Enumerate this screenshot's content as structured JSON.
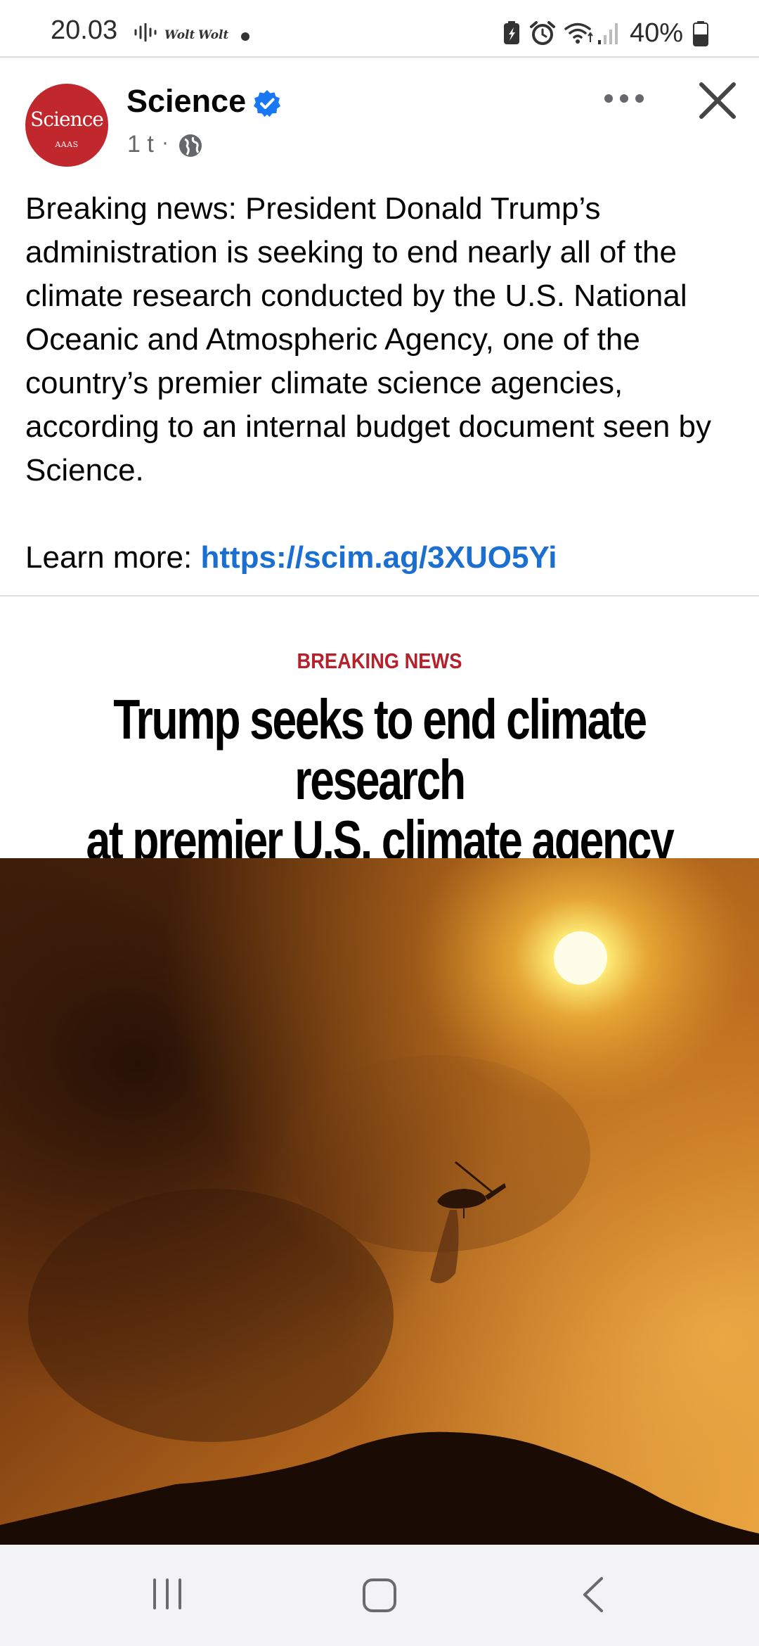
{
  "status_bar": {
    "time": "20.03",
    "notification_labels": [
      "Wolt",
      "Wolt"
    ],
    "battery": "40%"
  },
  "post": {
    "author": "Science",
    "avatar_word": "Science",
    "avatar_sub": "AAAS",
    "time": "1 t",
    "separator": "·",
    "text": "Breaking news: President Donald Trump’s administration is seeking to end nearly all of the climate research conducted by the U.S. National Oceanic and Atmospheric Agency, one of the country’s premier climate science agencies, according to an internal budget document seen by Science.",
    "learn_label": "Learn more: ",
    "link": "https://scim.ag/3XUO5Yi"
  },
  "preview": {
    "kicker": "BREAKING NEWS",
    "headline_line1": "Trump seeks to end climate research",
    "headline_line2": "at premier U.S. climate agency"
  },
  "colors": {
    "brand_red": "#c1282d",
    "link_blue": "#1b6fd1",
    "kicker_red": "#b5212b",
    "verified_blue": "#1877f2"
  },
  "icons": {
    "status_left": [
      "voice-recorder-icon",
      "wolt-icon",
      "wolt-icon",
      "notification-dot-icon"
    ],
    "status_right": [
      "battery-saver-icon",
      "alarm-icon",
      "wifi-icon",
      "signal-icon",
      "battery-icon"
    ],
    "header": [
      "verified-icon",
      "globe-icon",
      "more-icon",
      "close-icon"
    ],
    "nav": [
      "recent-apps-icon",
      "home-icon",
      "back-icon"
    ]
  }
}
